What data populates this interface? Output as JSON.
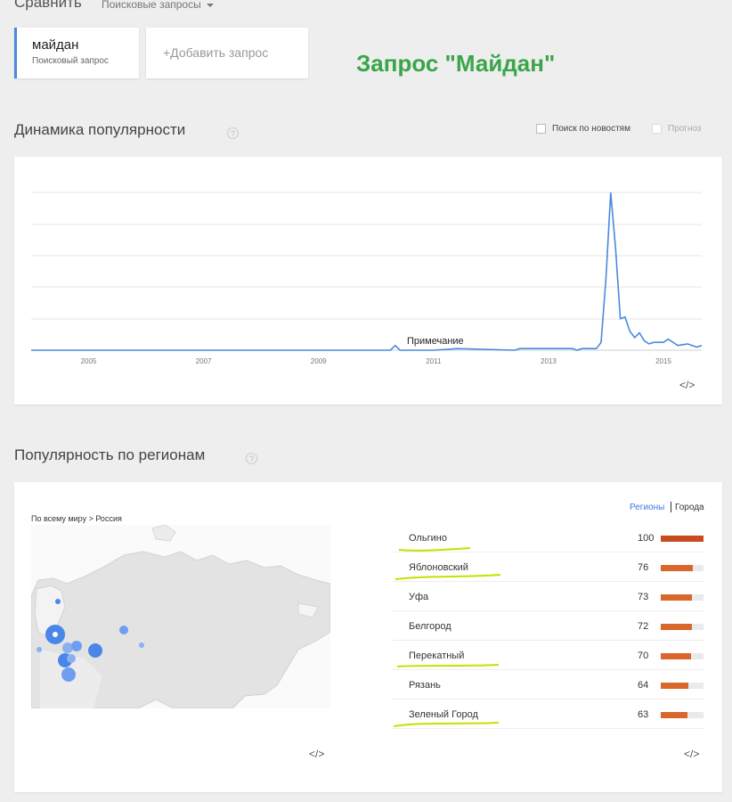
{
  "header": {
    "compare_label": "Сравнить",
    "queries_dropdown": "Поисковые запросы",
    "term": {
      "name": "майдан",
      "type": "Поисковый запрос",
      "accent": "#4a89dc"
    },
    "add_query": "+Добавить запрос",
    "overlay_title": "Запрос \"Майдан\""
  },
  "interest_over_time": {
    "title": "Динамика популярности",
    "help": "?",
    "news_search_label": "Поиск по новостям",
    "forecast_label": "Прогноз",
    "note_label": "Примечание",
    "embed": "</>"
  },
  "chart_data": {
    "type": "line",
    "x_ticks": [
      "2005",
      "2007",
      "2009",
      "2011",
      "2013",
      "2015"
    ],
    "xlim": [
      "2004-01",
      "2015-09"
    ],
    "ylim": [
      0,
      100
    ],
    "grid": true,
    "series": [
      {
        "color": "#4a89dc",
        "points": [
          [
            "2004-01",
            0
          ],
          [
            "2009-06",
            0
          ],
          [
            "2010-04",
            0
          ],
          [
            "2010-05",
            3
          ],
          [
            "2010-06",
            0
          ],
          [
            "2011-01",
            0
          ],
          [
            "2011-06",
            1
          ],
          [
            "2012-06",
            0
          ],
          [
            "2012-07",
            1
          ],
          [
            "2013-06",
            1
          ],
          [
            "2013-07",
            0
          ],
          [
            "2013-08",
            1
          ],
          [
            "2013-11",
            1
          ],
          [
            "2013-12",
            5
          ],
          [
            "2014-01",
            45
          ],
          [
            "2014-02",
            100
          ],
          [
            "2014-03",
            65
          ],
          [
            "2014-04",
            20
          ],
          [
            "2014-05",
            21
          ],
          [
            "2014-06",
            12
          ],
          [
            "2014-07",
            8
          ],
          [
            "2014-08",
            11
          ],
          [
            "2014-09",
            6
          ],
          [
            "2014-10",
            4
          ],
          [
            "2014-11",
            5
          ],
          [
            "2015-01",
            5
          ],
          [
            "2015-02",
            7
          ],
          [
            "2015-04",
            3
          ],
          [
            "2015-06",
            4
          ],
          [
            "2015-08",
            2
          ],
          [
            "2015-09",
            3
          ]
        ]
      }
    ]
  },
  "regional_interest": {
    "title": "Популярность по регионам",
    "help": "?",
    "breadcrumb": "По всему миру > Россия",
    "tab_regions": "Регионы",
    "tab_cities": "Города",
    "embed": "</>",
    "rows": [
      {
        "name": "Ольгино",
        "value": 100,
        "color": "#c84d1e"
      },
      {
        "name": "Яблоновский",
        "value": 76,
        "color": "#d9662b"
      },
      {
        "name": "Уфа",
        "value": 73,
        "color": "#d9662b"
      },
      {
        "name": "Белгород",
        "value": 72,
        "color": "#d9662b"
      },
      {
        "name": "Перекатный",
        "value": 70,
        "color": "#d9662b"
      },
      {
        "name": "Рязань",
        "value": 64,
        "color": "#d9662b"
      },
      {
        "name": "Зеленый Город",
        "value": 63,
        "color": "#d9662b"
      }
    ],
    "highlighted": [
      "Ольгино",
      "Яблоновский",
      "Перекатный",
      "Зеленый Город"
    ],
    "highlight_color": "#c8e000"
  }
}
